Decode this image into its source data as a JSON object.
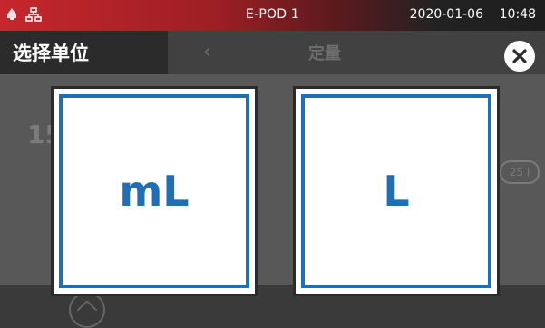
{
  "statusbar": {
    "device": "E-POD 1",
    "date": "2020-01-06",
    "time": "10:48",
    "icons": [
      "notification-bell-icon",
      "network-icon"
    ]
  },
  "background": {
    "header_title": "定量",
    "number": "15",
    "pill": "25 I"
  },
  "dialog": {
    "title": "选择单位",
    "options": [
      {
        "label": "mL"
      },
      {
        "label": "L"
      }
    ]
  },
  "colors": {
    "accent": "#1e6fb5",
    "statusbar_red": "#c7262e"
  }
}
